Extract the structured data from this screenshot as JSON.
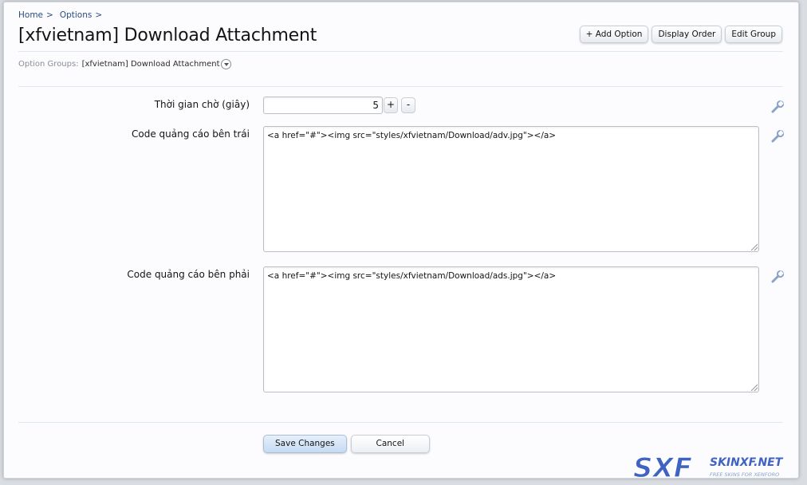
{
  "breadcrumb": {
    "home": "Home",
    "options": "Options",
    "sep": ">"
  },
  "page": {
    "title": "[xfvietnam] Download Attachment"
  },
  "top_buttons": {
    "add_option": "+ Add Option",
    "display_order": "Display Order",
    "edit_group": "Edit Group"
  },
  "groups": {
    "label": "Option Groups:",
    "value": "[xfvietnam] Download Attachment"
  },
  "options": [
    {
      "label": "Thời gian chờ (giây)",
      "value": "5",
      "plus": "+",
      "minus": "-"
    },
    {
      "label": "Code quảng cáo bên trái",
      "value": "<a href=\"#\"><img src=\"styles/xfvietnam/Download/adv.jpg\"></a>"
    },
    {
      "label": "Code quảng cáo bên phải",
      "value": "<a href=\"#\"><img src=\"styles/xfvietnam/Download/ads.jpg\"></a>"
    }
  ],
  "actions": {
    "save": "Save Changes",
    "cancel": "Cancel"
  },
  "watermark": {
    "logo": "SXF",
    "site": "SKINXF.NET",
    "tagline": "FREE SKINS FOR XENFORO"
  },
  "colors": {
    "link": "#2b4c7e",
    "primary_button": "#c6dbf2",
    "watermark": "#3f63c2"
  }
}
